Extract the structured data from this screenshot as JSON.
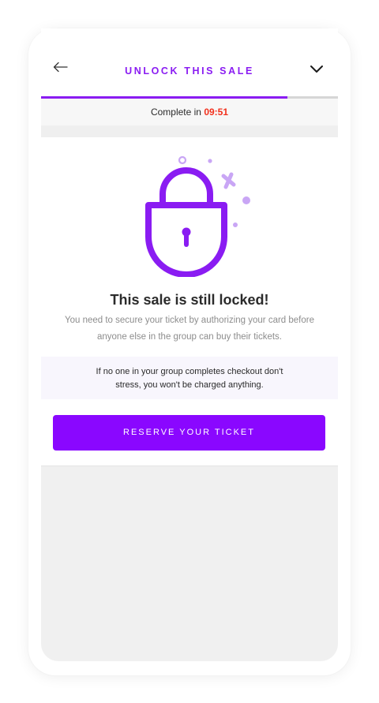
{
  "header": {
    "title": "UNLOCK THIS SALE",
    "back_icon": "arrow-left-icon",
    "collapse_icon": "chevron-down-icon"
  },
  "progress": {
    "fraction": 0.83
  },
  "timer": {
    "prefix": "Complete in ",
    "value": "09:51"
  },
  "lock": {
    "icon": "padlock-icon"
  },
  "main": {
    "heading": "This sale is still locked!",
    "description": "You need to secure your ticket by authorizing your card before anyone else in the group can buy their tickets.",
    "notice_line1": "If no one in your group completes checkout don't",
    "notice_line2": "stress, you won't be charged anything."
  },
  "cta": {
    "label": "RESERVE YOUR TICKET"
  },
  "colors": {
    "accent": "#8a07ff",
    "timer": "#f2301c"
  }
}
